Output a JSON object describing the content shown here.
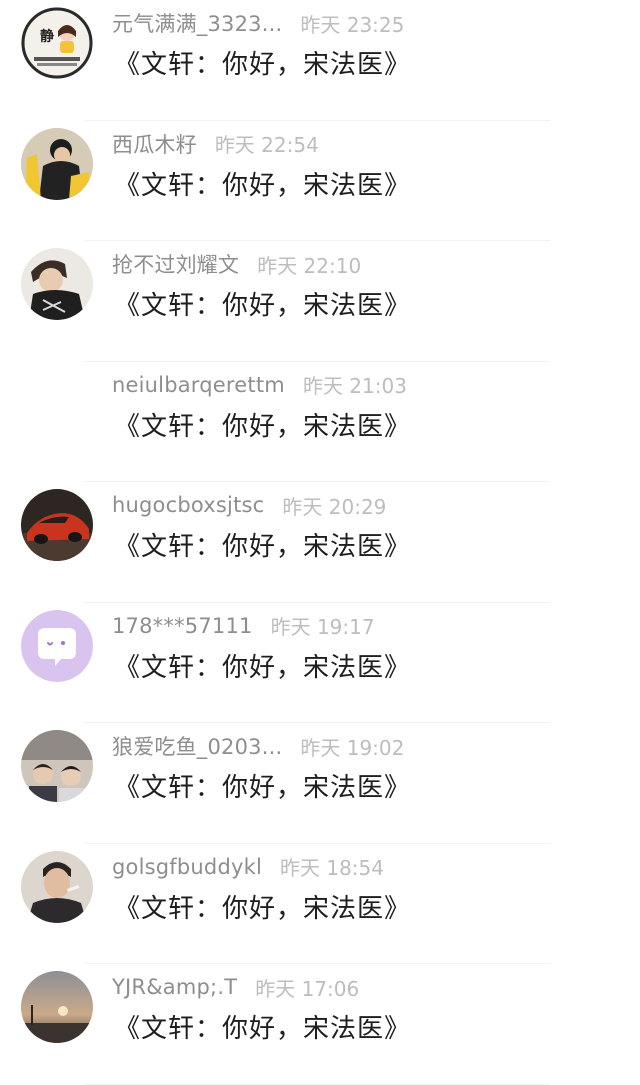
{
  "comments": [
    {
      "username": "元气满满_3323...",
      "time": "昨天 23:25",
      "text": "《文轩：你好，宋法医》",
      "avatar_icon": "profile-photo-icon"
    },
    {
      "username": "西瓜木籽",
      "time": "昨天 22:54",
      "text": "《文轩：你好，宋法医》",
      "avatar_icon": "profile-photo-icon"
    },
    {
      "username": "抢不过刘耀文",
      "time": "昨天 22:10",
      "text": "《文轩：你好，宋法医》",
      "avatar_icon": "profile-photo-icon"
    },
    {
      "username": "neiulbarqerettm",
      "time": "昨天 21:03",
      "text": "《文轩：你好，宋法医》",
      "avatar_icon": "no-avatar"
    },
    {
      "username": "hugocboxsjtsc",
      "time": "昨天 20:29",
      "text": "《文轩：你好，宋法医》",
      "avatar_icon": "car-photo-icon"
    },
    {
      "username": "178***57111",
      "time": "昨天 19:17",
      "text": "《文轩：你好，宋法医》",
      "avatar_icon": "default-chat-bubble-icon"
    },
    {
      "username": "狼爱吃鱼_0203...",
      "time": "昨天 19:02",
      "text": "《文轩：你好，宋法医》",
      "avatar_icon": "profile-photo-icon"
    },
    {
      "username": "golsgfbuddykl",
      "time": "昨天 18:54",
      "text": "《文轩：你好，宋法医》",
      "avatar_icon": "profile-photo-icon"
    },
    {
      "username": "YJR&amp;.T",
      "time": "昨天 17:06",
      "text": "《文轩：你好，宋法医》",
      "avatar_icon": "sunset-photo-icon"
    }
  ],
  "colors": {
    "username": "#8e8e8e",
    "timestamp": "#bdbdbd",
    "comment_text": "#1e1e1e",
    "default_avatar_bg": "#d8c4ee",
    "default_avatar_bubble": "#ffffff"
  }
}
